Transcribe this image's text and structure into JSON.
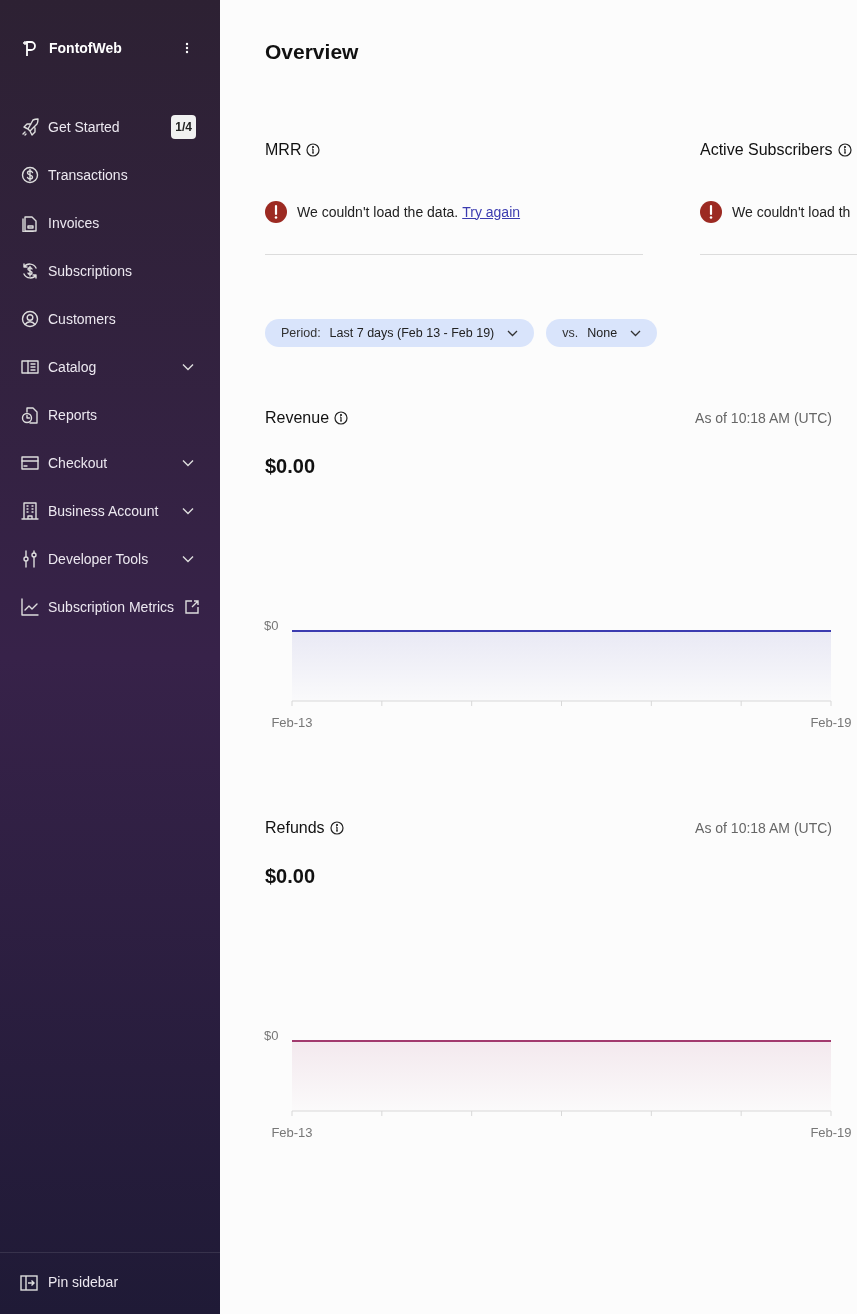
{
  "sidebar": {
    "brand": "FontofWeb",
    "items": [
      {
        "label": "Get Started",
        "badge": "1/4",
        "expandable": false,
        "external": false
      },
      {
        "label": "Transactions",
        "expandable": false,
        "external": false
      },
      {
        "label": "Invoices",
        "expandable": false,
        "external": false
      },
      {
        "label": "Subscriptions",
        "expandable": false,
        "external": false
      },
      {
        "label": "Customers",
        "expandable": false,
        "external": false
      },
      {
        "label": "Catalog",
        "expandable": true,
        "external": false
      },
      {
        "label": "Reports",
        "expandable": false,
        "external": false
      },
      {
        "label": "Checkout",
        "expandable": true,
        "external": false
      },
      {
        "label": "Business Account",
        "expandable": true,
        "external": false
      },
      {
        "label": "Developer Tools",
        "expandable": true,
        "external": false
      },
      {
        "label": "Subscription Metrics",
        "expandable": false,
        "external": true
      }
    ],
    "footer": "Pin sidebar"
  },
  "page_title": "Overview",
  "metrics": [
    {
      "title": "MRR",
      "error": "We couldn't load the data.",
      "link": "Try again"
    },
    {
      "title": "Active Subscribers",
      "error": "We couldn't load th"
    }
  ],
  "filters": [
    {
      "label": "Period:",
      "value": "Last 7 days (Feb 13 - Feb 19)"
    },
    {
      "label": "vs.",
      "value": "None"
    }
  ],
  "charts": [
    {
      "title": "Revenue",
      "as_of": "As of 10:18 AM (UTC)",
      "total": "$0.00",
      "color": "#3b3bb0",
      "y_label": "$0",
      "x_labels": [
        "Feb-13",
        "Feb-19"
      ]
    },
    {
      "title": "Refunds",
      "as_of": "As of 10:18 AM (UTC)",
      "total": "$0.00",
      "color": "#a23a6e",
      "y_label": "$0",
      "x_labels": [
        "Feb-13",
        "Feb-19"
      ]
    }
  ]
}
